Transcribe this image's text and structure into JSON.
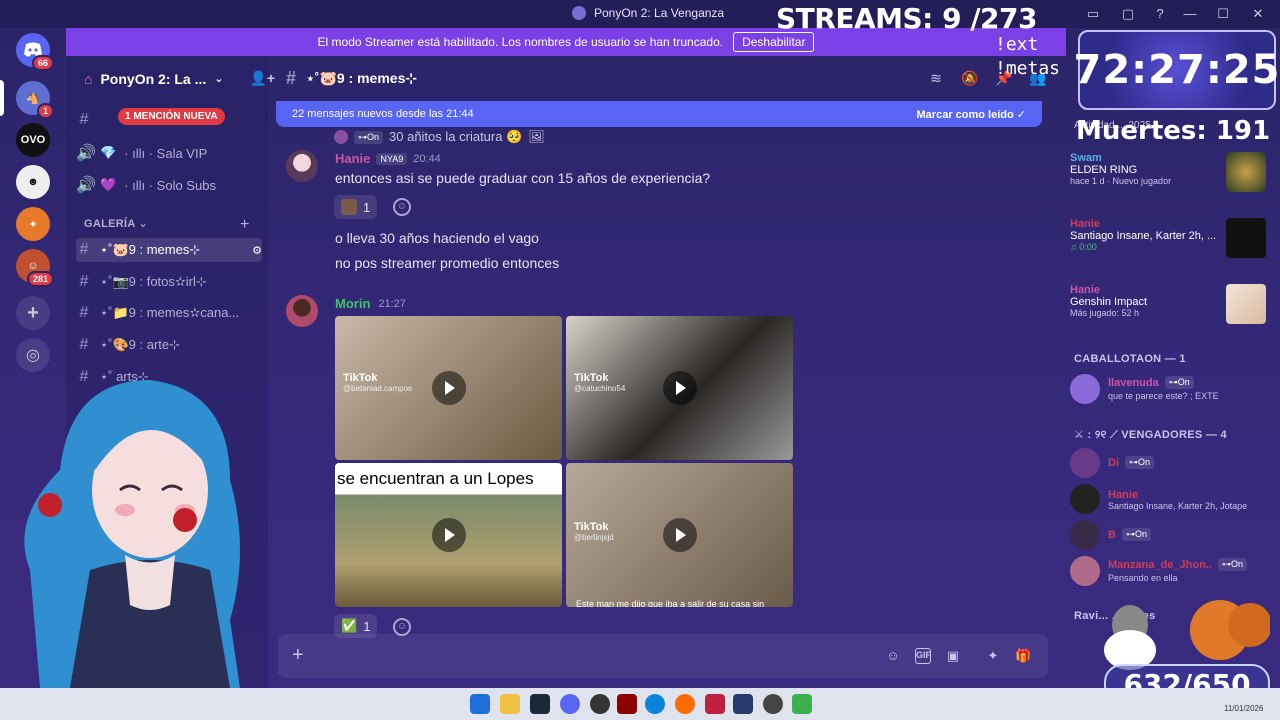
{
  "window": {
    "title": "PonyOn 2: La Venganza"
  },
  "banner": {
    "text": "El modo Streamer está habilitado. Los nombres de usuario se han truncado.",
    "button": "Deshabilitar"
  },
  "rail": {
    "badge_top": "66",
    "badge_1": "1",
    "badge_281": "281",
    "ovo": "OVO"
  },
  "server": {
    "name": "PonyOn 2: La ..."
  },
  "sidebar": {
    "mention": "1 MENCIÓN NUEVA",
    "voice": [
      {
        "label": "· ıllı · Sala VIP"
      },
      {
        "label": "· ıllı · Solo Subs"
      }
    ],
    "category": "GALERÍA",
    "channels": [
      {
        "label": "⋆˚🐷9 : memes⊹"
      },
      {
        "label": "⋆˚📷9 : fotos✫irl⊹"
      },
      {
        "label": "⋆˚📁9 : memes✫cana..."
      },
      {
        "label": "⋆˚🎨9 : arte⊹"
      },
      {
        "label": "⋆˚ arts⊹"
      }
    ]
  },
  "header": {
    "channel": "⋆˚🐷9 : memes⊹"
  },
  "newbar": {
    "text": "22 mensajes nuevos desde las 21:44",
    "action": "Marcar como leído"
  },
  "messages": {
    "reply": {
      "tag": "⊶On",
      "text": "30 añitos la criatura 🥺"
    },
    "m1": {
      "author": "Hanie",
      "tag": "NYA9",
      "time": "20:44",
      "lines": [
        "entonces asi se puede graduar con 15 años de experiencia?"
      ],
      "reaction_count": "1"
    },
    "m1b": {
      "lines": [
        "o lleva 30 años haciendo el vago",
        "no pos streamer promedio entonces"
      ]
    },
    "m2": {
      "author": "Morin",
      "time": "21:27",
      "reaction_count": "1",
      "videos": [
        {
          "brand": "TikTok",
          "handle": "@betaniad.campos"
        },
        {
          "brand": "TikTok",
          "handle": "@catuchino54"
        },
        {
          "overlay": "se encuentran a un Lopes"
        },
        {
          "brand": "TikTok",
          "handle": "@berlinjsjd",
          "caption": "Este man me dijo que iba a salir de su casa sin"
        }
      ]
    }
  },
  "members": {
    "activity_header": "Actividad ... 2025",
    "activities": [
      {
        "user": "Swam",
        "game": "ELDEN RING",
        "sub": "hace 1 d · Nuevo jugador"
      },
      {
        "user": "Hanie",
        "game": "Santiago Insane, Karter 2h, ...",
        "sub": "♫ 0:00"
      },
      {
        "user": "Hanie",
        "game": "Genshin Impact",
        "sub": "Más jugado: 52 h"
      }
    ],
    "group1": "CABALLOTAON — 1",
    "g1": [
      {
        "name": "llavenuda",
        "tag": "⊶On",
        "status": "que te parece este? ; EXTE"
      }
    ],
    "group2": "⚔ : ୨୧ ⟋ VENGADORES — 4",
    "g2": [
      {
        "name": "Di",
        "tag": "⊶On",
        "status": ""
      },
      {
        "name": "Hanie",
        "tag": "",
        "status": "Santiago Insane, Karter 2h, Jotape"
      },
      {
        "name": "B",
        "tag": "⊶On",
        "status": ""
      },
      {
        "name": "Manzana_de_Jhon...",
        "tag": "⊶On",
        "status": "Pensando en ella"
      }
    ],
    "group3": "Ravi... ...alotes"
  },
  "overlay": {
    "streams": "STREAMS: 9 /273",
    "ext": "!ext",
    "metas": "!metas",
    "timer": "72:27:25",
    "deaths": "Muertes: 191",
    "counter": "632/650"
  },
  "taskbar": {
    "date": "11/01/2026"
  }
}
